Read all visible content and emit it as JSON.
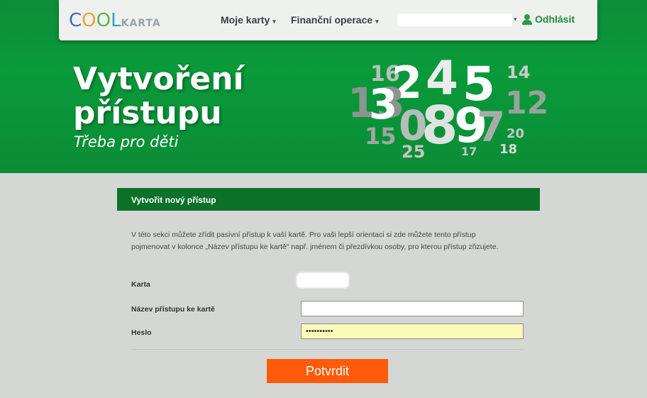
{
  "header": {
    "logo_main": [
      "C",
      "O",
      "O",
      "L"
    ],
    "logo_sub": "KARTA",
    "nav": [
      {
        "label": "Moje karty",
        "caret": "▾"
      },
      {
        "label": "Finanční operace",
        "caret": "▾"
      }
    ],
    "user_caret": "▾",
    "logout_label": "Odhlásit"
  },
  "hero": {
    "title": "Vytvoření přístupu",
    "subtitle": "Třeba pro děti",
    "numbers": [
      "16",
      "2",
      "4",
      "5",
      "14",
      "13",
      "3",
      "12",
      "15",
      "0",
      "8",
      "9",
      "7",
      "20",
      "25",
      "17",
      "18"
    ]
  },
  "form": {
    "panel_title": "Vytvořit nový přístup",
    "intro": "V této sekci můžete zřídit pasivní přístup k vaší kartě. Pro vaši lepší orientaci si zde můžete tento přístup pojmenovat v kolonce „Název přístupu ke kartě“ např. jménem či přezdívkou osoby, pro kterou přístup zřizujete.",
    "card_label": "Karta",
    "name_label": "Název přístupu ke kartě",
    "name_value": "",
    "password_label": "Heslo",
    "password_value": "**********",
    "submit_label": "Potvrdit"
  },
  "colors": {
    "hero_green": "#0a9a3a",
    "panel_green": "#0c7129",
    "submit_orange": "#ff5b0a",
    "logout_green": "#218a3a"
  }
}
